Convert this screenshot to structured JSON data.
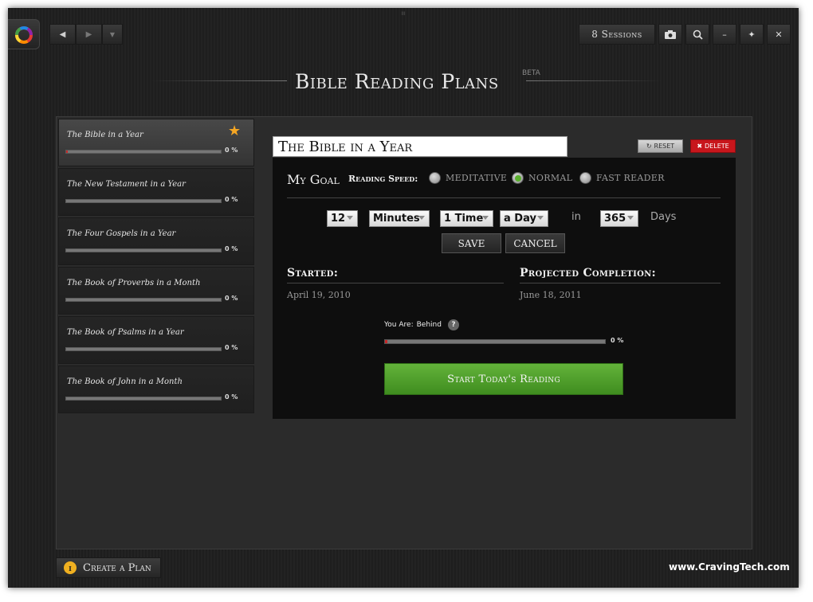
{
  "window": {
    "sessions_label": "8 Sessions"
  },
  "nav": {
    "back": "◀",
    "forward": "▶",
    "menu": "▼"
  },
  "window_controls": {
    "minimize": "–",
    "maximize": "✦",
    "close": "✕"
  },
  "header": {
    "title": "Bible Reading Plans",
    "beta": "BETA"
  },
  "plans": [
    {
      "name": "The Bible in a Year",
      "percent": "0 %",
      "progress": 0.01,
      "starred": true,
      "active": true
    },
    {
      "name": "The New Testament in a Year",
      "percent": "0 %",
      "progress": 0.0,
      "starred": false,
      "active": false
    },
    {
      "name": "The Four Gospels in a Year",
      "percent": "0 %",
      "progress": 0.0,
      "starred": false,
      "active": false
    },
    {
      "name": "The Book of Proverbs in a Month",
      "percent": "0 %",
      "progress": 0.0,
      "starred": false,
      "active": false
    },
    {
      "name": "The Book of Psalms in a Year",
      "percent": "0 %",
      "progress": 0.0,
      "starred": false,
      "active": false
    },
    {
      "name": "The Book of John in a Month",
      "percent": "0 %",
      "progress": 0.0,
      "starred": false,
      "active": false
    }
  ],
  "detail": {
    "plan_title": "The Bible in a Year",
    "reset_label": "RESET",
    "delete_label": "DELETE",
    "goal_heading": "My Goal",
    "speed_label": "Reading Speed:",
    "speed_options": [
      {
        "label": "MEDITATIVE",
        "selected": false
      },
      {
        "label": "NORMAL",
        "selected": true
      },
      {
        "label": "FAST READER",
        "selected": false
      }
    ],
    "amount": "12",
    "unit": "Minutes",
    "times": "1 Time",
    "period": "a Day",
    "in_word": "in",
    "days_value": "365",
    "days_word": "Days",
    "save_label": "SAVE",
    "cancel_label": "CANCEL",
    "started_heading": "Started:",
    "started_date": "April 19, 2010",
    "projected_heading": "Projected Completion:",
    "projected_date": "June 18, 2011",
    "you_are_label": "You Are:",
    "status": "Behind",
    "help": "?",
    "progress_percent": "0 %",
    "progress": 0.01,
    "start_button": "Start Today's Reading"
  },
  "footer": {
    "create_label": "Create a Plan",
    "info": "i",
    "watermark": "www.CravingTech.com"
  },
  "colors": {
    "accent_green": "#5ab02e",
    "delete_red": "#c8161c",
    "star": "#f5a623"
  }
}
